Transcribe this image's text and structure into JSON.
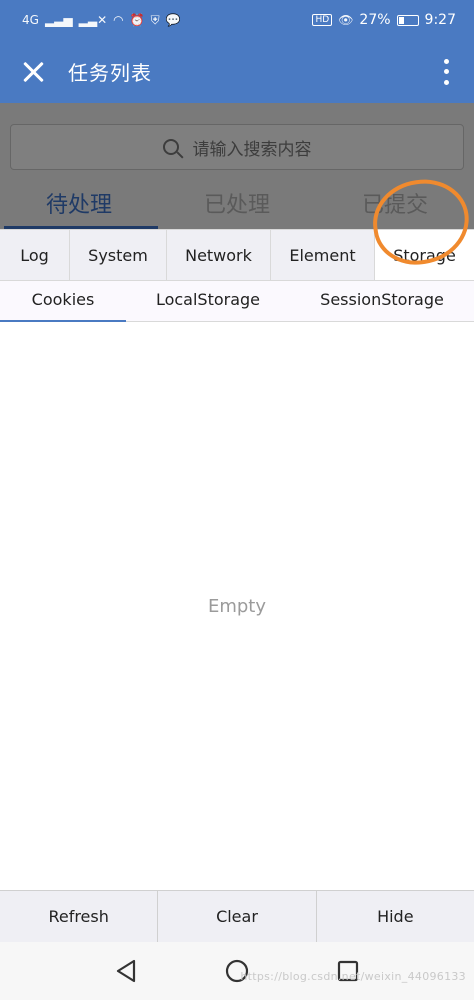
{
  "status_bar": {
    "network": "4G",
    "battery_percent": "27%",
    "battery_level": 0.27,
    "hd_label": "HD",
    "time": "9:27"
  },
  "app_bar": {
    "title": "任务列表",
    "close_icon": "close-icon",
    "more_icon": "more-vertical-icon"
  },
  "page_behind": {
    "search_placeholder": "请输入搜索内容",
    "tabs": [
      {
        "label": "待处理",
        "active": true
      },
      {
        "label": "已处理",
        "active": false
      },
      {
        "label": "已提交",
        "active": false
      }
    ]
  },
  "vconsole": {
    "tabs": [
      {
        "label": "Log",
        "active": false
      },
      {
        "label": "System",
        "active": false
      },
      {
        "label": "Network",
        "active": false
      },
      {
        "label": "Element",
        "active": false
      },
      {
        "label": "Storage",
        "active": true
      }
    ],
    "subtabs": [
      {
        "label": "Cookies",
        "active": true
      },
      {
        "label": "LocalStorage",
        "active": false
      },
      {
        "label": "SessionStorage",
        "active": false
      }
    ],
    "empty_text": "Empty",
    "actions": {
      "refresh": "Refresh",
      "clear": "Clear",
      "hide": "Hide"
    }
  },
  "nav": {
    "back_icon": "back-triangle-icon",
    "home_icon": "home-circle-icon",
    "recents_icon": "recents-square-icon"
  },
  "watermark": "https://blog.csdn.net/weixin_44096133",
  "colors": {
    "primary": "#4a7ac2",
    "annotation": "#f08a2e"
  }
}
